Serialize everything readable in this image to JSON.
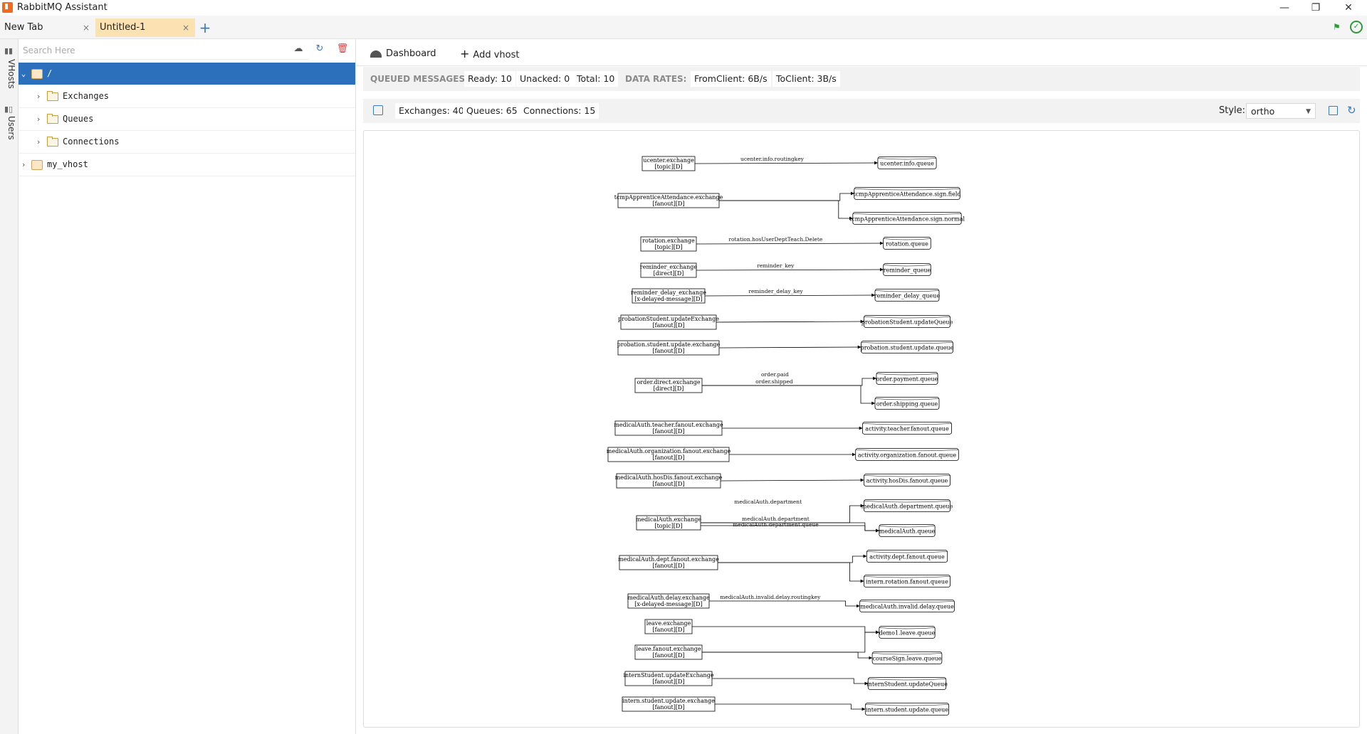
{
  "app": {
    "title": "RabbitMQ Assistant",
    "window_controls": {
      "minimize": "—",
      "maximize": "❐",
      "close": "✕"
    }
  },
  "tabs": [
    {
      "label": "New Tab",
      "close": "×"
    },
    {
      "label": "Untitled-1",
      "close": "×"
    }
  ],
  "tab_add": "+",
  "rail": {
    "vhosts": "VHosts",
    "users": "Users"
  },
  "tree": {
    "search_placeholder": "Search Here",
    "items": [
      {
        "label": "/",
        "level": 0,
        "selected": true,
        "expanded": true
      },
      {
        "label": "Exchanges",
        "level": 1
      },
      {
        "label": "Queues",
        "level": 1
      },
      {
        "label": "Connections",
        "level": 1
      },
      {
        "label": "my_vhost",
        "level": 0
      }
    ]
  },
  "main_tabs": [
    {
      "label": "Dashboard",
      "icon": "dashboard-icon"
    },
    {
      "label": "Add vhost",
      "icon": "plus-icon"
    }
  ],
  "stats": {
    "queued_label": "QUEUED MESSAGES:",
    "ready": "Ready: 10",
    "unacked": "Unacked: 0",
    "total": "Total: 10",
    "rates_label": "DATA RATES:",
    "from_client": "FromClient: 6B/s",
    "to_client": "ToClient: 3B/s"
  },
  "toolbar": {
    "exchanges": "Exchanges: 40",
    "queues": "Queues: 65",
    "connections": "Connections: 15",
    "style_label": "Style:",
    "style_value": "ortho"
  },
  "graph": {
    "exchanges": [
      {
        "name": "ucenter.exchange",
        "type": "[topic][D]"
      },
      {
        "name": "tcmpApprenticeAttendance.exchange",
        "type": "[fanout][D]"
      },
      {
        "name": "rotation.exchange",
        "type": "[topic][D]"
      },
      {
        "name": "reminder_exchange",
        "type": "[direct][D]"
      },
      {
        "name": "reminder_delay_exchange",
        "type": "[x-delayed-message][D]"
      },
      {
        "name": "probationStudent.updateExchange",
        "type": "[fanout][D]"
      },
      {
        "name": "probation.student.update.exchange",
        "type": "[fanout][D]"
      },
      {
        "name": "order.direct.exchange",
        "type": "[direct][D]"
      },
      {
        "name": "medicalAuth.teacher.fanout.exchange",
        "type": "[fanout][D]"
      },
      {
        "name": "medicalAuth.organization.fanout.exchange",
        "type": "[fanout][D]"
      },
      {
        "name": "medicalAuth.hosDis.fanout.exchange",
        "type": "[fanout][D]"
      },
      {
        "name": "medicalAuth.exchange",
        "type": "[topic][D]"
      },
      {
        "name": "medicalAuth.dept.fanout.exchange",
        "type": "[fanout][D]"
      },
      {
        "name": "medicalAuth.delay.exchange",
        "type": "[x-delayed-message][D]"
      },
      {
        "name": "leave.exchange",
        "type": "[fanout][D]"
      },
      {
        "name": "leave.fanout.exchange",
        "type": "[fanout][D]"
      },
      {
        "name": "internStudent.updateExchange",
        "type": "[fanout][D]"
      },
      {
        "name": "intern.student.update.exchange",
        "type": "[fanout][D]"
      }
    ],
    "queues": [
      "ucenter.info.queue",
      "tcmpApprenticeAttendance.sign.field",
      "tcmpApprenticeAttendance.sign.normal",
      "rotation.queue",
      "reminder_queue",
      "reminder_delay_queue",
      "probationStudent.updateQueue",
      "probation.student.update.queue",
      "order.payment.queue",
      "order.shipping.queue",
      "activity.teacher.fanout.queue",
      "activity.organization.fanout.queue",
      "activity.hosDis.fanout.queue",
      "medicalAuth.department.queue",
      "medicalAuth.queue",
      "activity.dept.fanout.queue",
      "intern.rotation.fanout.queue",
      "medicalAuth.invalid.delay.queue",
      "demo1.leave.queue",
      "courseSign.leave.queue",
      "internStudent.updateQueue",
      "intern.student.update.queue"
    ],
    "bindings": [
      {
        "from": 0,
        "to": 0,
        "key": "ucenter.info.routingkey"
      },
      {
        "from": 1,
        "to": 1,
        "key": ""
      },
      {
        "from": 1,
        "to": 2,
        "key": ""
      },
      {
        "from": 2,
        "to": 3,
        "key": "rotation.hosUserDeptTeach.Delete"
      },
      {
        "from": 3,
        "to": 4,
        "key": "reminder_key"
      },
      {
        "from": 4,
        "to": 5,
        "key": "reminder_delay_key"
      },
      {
        "from": 5,
        "to": 6,
        "key": ""
      },
      {
        "from": 6,
        "to": 7,
        "key": ""
      },
      {
        "from": 7,
        "to": 8,
        "key": "order.paid"
      },
      {
        "from": 7,
        "to": 9,
        "key": "order.shipped"
      },
      {
        "from": 8,
        "to": 10,
        "key": ""
      },
      {
        "from": 9,
        "to": 11,
        "key": ""
      },
      {
        "from": 10,
        "to": 12,
        "key": ""
      },
      {
        "from": 11,
        "to": 13,
        "key": "medicalAuth.department"
      },
      {
        "from": 11,
        "to": 14,
        "key": "medicalAuth.department"
      },
      {
        "from": 11,
        "to": 14,
        "key": "medicalAuth.department.queue"
      },
      {
        "from": 12,
        "to": 15,
        "key": ""
      },
      {
        "from": 12,
        "to": 16,
        "key": ""
      },
      {
        "from": 13,
        "to": 17,
        "key": "medicalAuth.invalid.delay.routingkey"
      },
      {
        "from": 14,
        "to": 18,
        "key": ""
      },
      {
        "from": 15,
        "to": 18,
        "key": ""
      },
      {
        "from": 15,
        "to": 19,
        "key": ""
      },
      {
        "from": 16,
        "to": 20,
        "key": ""
      },
      {
        "from": 17,
        "to": 21,
        "key": ""
      }
    ]
  }
}
